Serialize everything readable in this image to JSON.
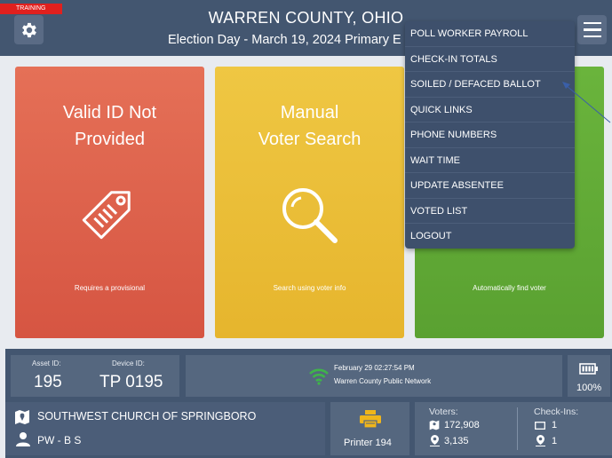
{
  "header": {
    "training_badge": "TRAINING",
    "title": "WARREN COUNTY, OHIO",
    "subtitle": "Election Day - March 19, 2024 Primary E"
  },
  "cards": [
    {
      "title_line1": "Valid ID Not",
      "title_line2": "Provided",
      "caption": "Requires a provisional",
      "icon": "tag-icon",
      "color": "#d65542"
    },
    {
      "title_line1": "Manual",
      "title_line2": "Voter Search",
      "caption": "Search using voter info",
      "icon": "magnifier-icon",
      "color": "#e6b52d"
    },
    {
      "title_line1": "",
      "title_line2": "",
      "caption": "Automatically find voter",
      "icon": "",
      "color": "#5aa131"
    }
  ],
  "menu": {
    "items": [
      "POLL WORKER PAYROLL",
      "CHECK-IN TOTALS",
      "SOILED / DEFACED BALLOT",
      "QUICK LINKS",
      "PHONE NUMBERS",
      "WAIT TIME",
      "UPDATE ABSENTEE",
      "VOTED LIST",
      "LOGOUT"
    ]
  },
  "status": {
    "asset_label": "Asset ID:",
    "asset_value": "195",
    "device_label": "Device ID:",
    "device_value": "TP 0195",
    "datetime": "February 29  02:27:54 PM",
    "network": "Warren County Public Network",
    "battery": "100%",
    "location": "SOUTHWEST CHURCH OF SPRINGBORO",
    "precinct": "PW - B S",
    "printer": "Printer 194",
    "voters_label": "Voters:",
    "voters_total": "172,908",
    "voters_precinct": "3,135",
    "checkins_label": "Check-Ins:",
    "checkins_device": "1",
    "checkins_precinct": "1"
  },
  "colors": {
    "header_bg": "#435670",
    "wifi_green": "#3fb44a",
    "printer_yellow": "#f0b61b",
    "training_red": "#e0201e"
  }
}
